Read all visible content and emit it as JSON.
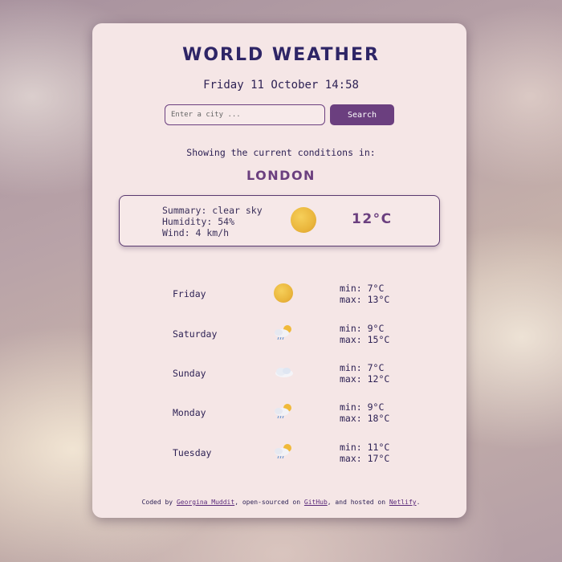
{
  "app": {
    "title": "WORLD WEATHER",
    "datetime": "Friday 11 October 14:58"
  },
  "search": {
    "placeholder": "Enter a city ...",
    "button_label": "Search"
  },
  "current": {
    "showing_text": "Showing the current conditions in:",
    "city": "LONDON",
    "summary": "Summary: clear sky",
    "humidity": "Humidity: 54%",
    "wind": "Wind: 4 km/h",
    "icon": "sun-icon",
    "temperature": "12°C"
  },
  "forecast": [
    {
      "day": "Friday",
      "icon": "sun-icon",
      "min": "min: 7°C",
      "max": "max: 13°C"
    },
    {
      "day": "Saturday",
      "icon": "sun-cloud-rain-icon",
      "min": "min: 9°C",
      "max": "max: 15°C"
    },
    {
      "day": "Sunday",
      "icon": "cloud-icon",
      "min": "min: 7°C",
      "max": "max: 12°C"
    },
    {
      "day": "Monday",
      "icon": "sun-cloud-rain-icon",
      "min": "min: 9°C",
      "max": "max: 18°C"
    },
    {
      "day": "Tuesday",
      "icon": "sun-cloud-rain-icon",
      "min": "min: 11°C",
      "max": "max: 17°C"
    }
  ],
  "footer": {
    "prefix": "Coded by ",
    "author": "Georgina Muddit",
    "middle1": ", open-sourced on ",
    "github": "GitHub",
    "middle2": ", and hosted on ",
    "netlify": "Netlify",
    "suffix": "."
  },
  "colors": {
    "accent": "#6b3f7f",
    "text": "#2e2255",
    "card": "#f5e6e6"
  }
}
